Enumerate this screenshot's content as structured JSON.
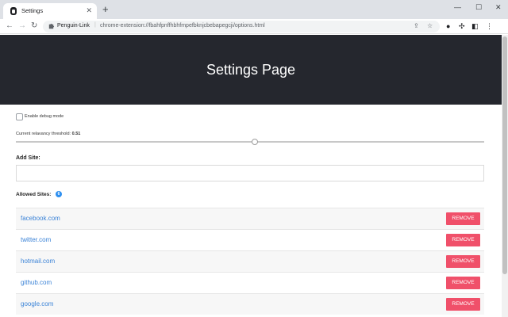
{
  "browser": {
    "tab_title": "Settings",
    "new_tab_symbol": "+",
    "tab_close_symbol": "✕",
    "window_minimize": "—",
    "window_maximize": "☐",
    "window_close": "✕",
    "extension_name": "Penguin-Link",
    "url": "chrome-extension://fbahfpnffhbhfmpefbknjcbebapegcji/options.html",
    "icons": {
      "back": "back-arrow-icon",
      "forward": "forward-arrow-icon",
      "reload": "reload-icon",
      "share": "share-icon",
      "bookmark": "star-icon",
      "profile": "profile-icon",
      "extensions": "puzzle-icon",
      "sidepanel": "sidepanel-icon",
      "menu": "kebab-menu-icon"
    }
  },
  "page": {
    "header_title": "Settings Page",
    "header_bg": "#25272e",
    "debug_label": "Enable debug mode",
    "debug_checked": false,
    "threshold_label": "Current relavancy threshold:",
    "threshold_value": "0.51",
    "add_site_label": "Add Site:",
    "add_site_value": "",
    "allowed_label": "Allowed Sites:",
    "allowed_count": "6",
    "link_color": "#3b83d7",
    "remove_color": "#f0506a",
    "sites": [
      {
        "domain": "facebook.com",
        "remove_label": "REMOVE"
      },
      {
        "domain": "twitter.com",
        "remove_label": "REMOVE"
      },
      {
        "domain": "hotmail.com",
        "remove_label": "REMOVE"
      },
      {
        "domain": "github.com",
        "remove_label": "REMOVE"
      },
      {
        "domain": "google.com",
        "remove_label": "REMOVE"
      }
    ]
  }
}
